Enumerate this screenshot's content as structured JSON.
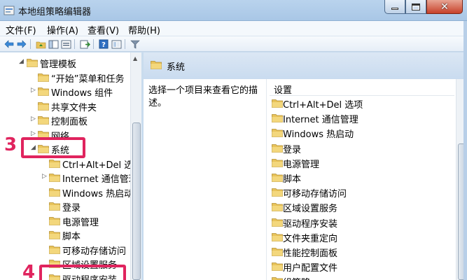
{
  "window": {
    "title": "本地组策略编辑器",
    "close_glyph": "✕"
  },
  "menu": [
    {
      "label": "文件(F)"
    },
    {
      "label": "操作(A)"
    },
    {
      "label": "查看(V)"
    },
    {
      "label": "帮助(H)"
    }
  ],
  "toolbar": {
    "icons": [
      "back-icon",
      "forward-icon",
      "up-folder-icon",
      "show-hide-tree-icon",
      "export-list-icon",
      "help-icon",
      "properties-icon",
      "filter-icon"
    ]
  },
  "tree": {
    "items": [
      {
        "label": "管理模板",
        "arrow": "◢"
      },
      {
        "label": "“开始”菜单和任务",
        "arrow": ""
      },
      {
        "label": "Windows 组件",
        "arrow": "▷"
      },
      {
        "label": "共享文件夹",
        "arrow": ""
      },
      {
        "label": "控制面板",
        "arrow": "▷"
      },
      {
        "label": "网络",
        "arrow": "▷"
      },
      {
        "label": "系统",
        "arrow": "◢"
      },
      {
        "label": "Ctrl+Alt+Del 选项",
        "arrow": ""
      },
      {
        "label": "Internet 通信管理",
        "arrow": "▷"
      },
      {
        "label": "Windows 热启动",
        "arrow": ""
      },
      {
        "label": "登录",
        "arrow": ""
      },
      {
        "label": "电源管理",
        "arrow": ""
      },
      {
        "label": "脚本",
        "arrow": ""
      },
      {
        "label": "可移动存储访问",
        "arrow": ""
      },
      {
        "label": "区域设置服务",
        "arrow": ""
      },
      {
        "label": "驱动程序安装",
        "arrow": ""
      }
    ],
    "scroll_up_glyph": "▲"
  },
  "details": {
    "header": "系统",
    "description": "选择一个项目来查看它的描述。",
    "column_header": "设置",
    "settings": [
      {
        "label": "Ctrl+Alt+Del 选项"
      },
      {
        "label": "Internet 通信管理"
      },
      {
        "label": "Windows 热启动"
      },
      {
        "label": "登录"
      },
      {
        "label": "电源管理"
      },
      {
        "label": "脚本"
      },
      {
        "label": "可移动存储访问"
      },
      {
        "label": "区域设置服务"
      },
      {
        "label": "驱动程序安装"
      },
      {
        "label": "文件夹重定向"
      },
      {
        "label": "性能控制面板"
      },
      {
        "label": "用户配置文件"
      },
      {
        "label": "组策略"
      }
    ]
  },
  "annotations": [
    {
      "number": "3"
    },
    {
      "number": "4"
    }
  ],
  "colors": {
    "callout": "#e0245e",
    "folder": "#e8c35a"
  }
}
